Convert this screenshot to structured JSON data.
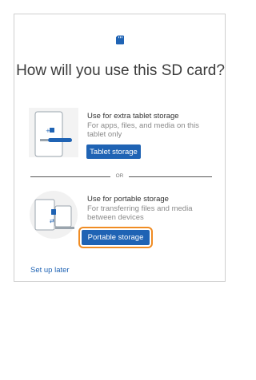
{
  "title": "How will you use this SD card?",
  "divider_label": "OR",
  "options": [
    {
      "heading": "Use for extra tablet storage",
      "description": "For apps, files, and media on this tablet only",
      "button_label": "Tablet storage",
      "illustration": "tablet-storage-illustration"
    },
    {
      "heading": "Use for portable storage",
      "description": "For transferring files and media between devices",
      "button_label": "Portable storage",
      "illustration": "portable-storage-illustration"
    }
  ],
  "footer": {
    "setup_later_label": "Set up later"
  },
  "colors": {
    "accent": "#1f63b4",
    "focus": "#f08c23",
    "illustration_bg": "#f1f1f1",
    "border": "#cfcfcf"
  }
}
